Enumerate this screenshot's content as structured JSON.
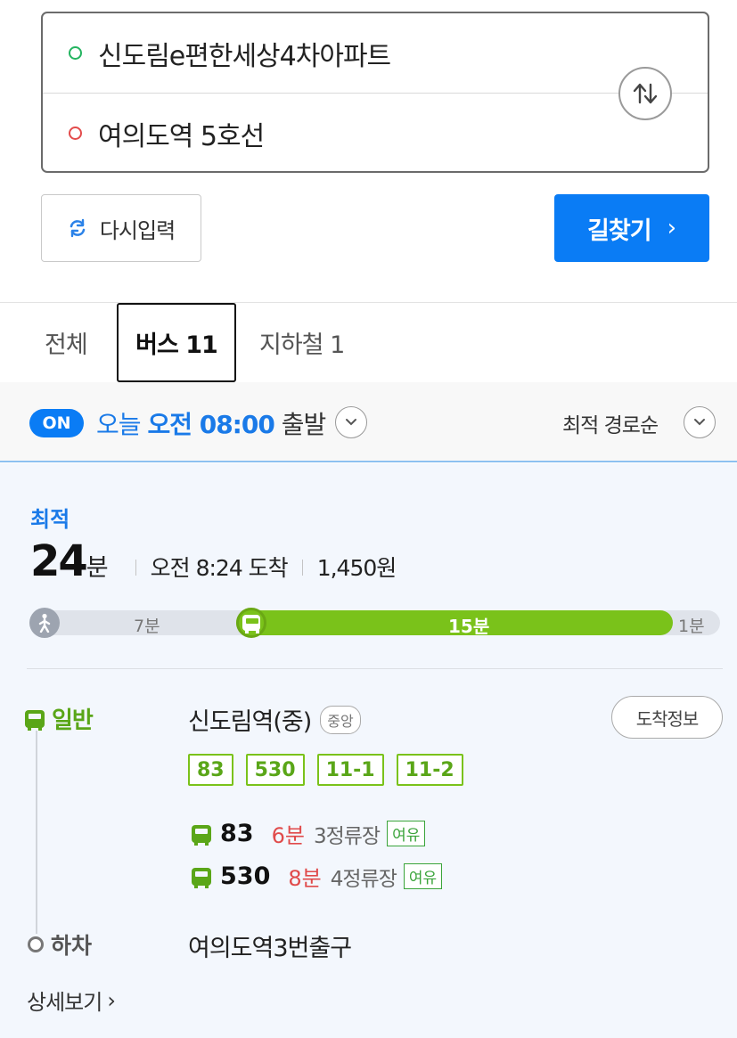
{
  "search": {
    "origin": "신도림e편한세상4차아파트",
    "destination": "여의도역 5호선"
  },
  "actions": {
    "reset_label": "다시입력",
    "find_label": "길찾기",
    "find_chevron": "›"
  },
  "tabs": [
    {
      "label": "전체"
    },
    {
      "label": "버스 11"
    },
    {
      "label": "지하철 1"
    }
  ],
  "filter": {
    "on_badge": "ON",
    "day": "오늘",
    "time": "오전 08:00",
    "suffix": "출발",
    "sort_label": "최적 경로순"
  },
  "route": {
    "best_label": "최적",
    "duration_value": "24",
    "duration_unit": "분",
    "arrival": "오전 8:24 도착",
    "fare": "1,450원",
    "timeline": {
      "walk_label": "7분",
      "bus_label": "15분",
      "end_label": "1분",
      "walk_minutes": 7,
      "bus_minutes": 15,
      "end_minutes": 1
    },
    "leg": {
      "type_label": "일반",
      "stop_name": "신도림역(중)",
      "stop_badge": "중앙",
      "arrival_info_label": "도착정보",
      "bus_chips": [
        "83",
        "530",
        "11-1",
        "11-2"
      ],
      "arrivals": [
        {
          "number": "83",
          "time": "6분",
          "stops": "3정류장",
          "crowd": "여유"
        },
        {
          "number": "530",
          "time": "8분",
          "stops": "4정류장",
          "crowd": "여유"
        }
      ]
    },
    "alight_label": "하차",
    "alight_stop": "여의도역3번출구",
    "detail_label": "상세보기",
    "detail_chevron": "›"
  },
  "colors": {
    "primary_blue": "#0a7cf5",
    "bus_green": "#7ac21a",
    "late_red": "#e04a4a",
    "crowd_green": "#3aa43a"
  }
}
